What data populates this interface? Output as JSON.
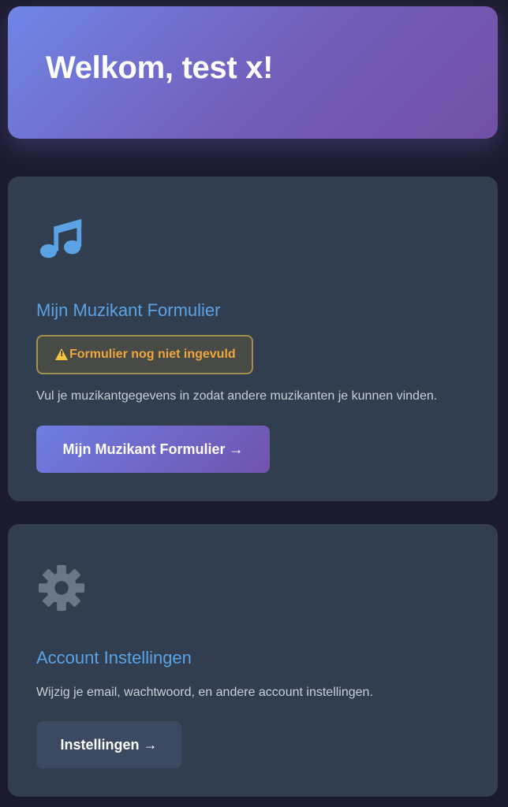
{
  "header": {
    "title": "Welkom, test x!"
  },
  "music_card": {
    "icon": "music-note-icon",
    "title": "Mijn Muzikant Formulier",
    "warning": "Formulier nog niet ingevuld",
    "warning_icon": "warning-icon",
    "description": "Vul je muzikantgegevens in zodat andere muzikanten je kunnen vinden.",
    "button_label": "Mijn Muzikant Formulier →"
  },
  "settings_card": {
    "icon": "gear-icon",
    "title": "Account Instellingen",
    "description": "Wijzig je email, wachtwoord, en andere account instellingen.",
    "button_label": "Instellingen →"
  },
  "colors": {
    "background": "#1c1b2e",
    "card": "#303e50",
    "accent_title": "#5aa2e3",
    "warning_text": "#efa53f",
    "warning_border": "#a48e4d",
    "gradient_start": "#6f85e6",
    "gradient_end": "#7150a6"
  }
}
